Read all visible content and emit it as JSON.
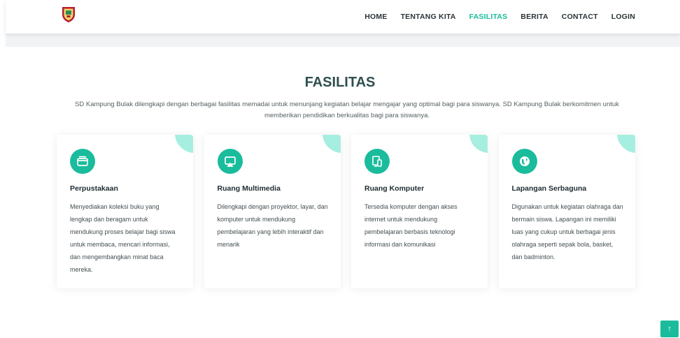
{
  "nav": {
    "items": [
      "HOME",
      "TENTANG KITA",
      "FASILITAS",
      "BERITA",
      "CONTACT",
      "LOGIN"
    ],
    "active": "FASILITAS"
  },
  "section": {
    "title": "FASILITAS",
    "description": "SD Kampung Bulak dilengkapi dengan berbagai fasilitas memadai untuk menunjang kegiatan belajar mengajar yang optimal bagi para siswanya. SD Kampung Bulak berkomitmen untuk memberikan pendidikan berkualitas bagi para siswanya."
  },
  "facilities": [
    {
      "icon": "library-box-icon",
      "title": "Perpustakaan",
      "text": "Menyediakan koleksi buku yang lengkap dan beragam untuk mendukung proses belajar bagi siswa untuk membaca, mencari informasi, dan mengembangkan minat baca mereka."
    },
    {
      "icon": "airplay-screen-icon",
      "title": "Ruang Multimedia",
      "text": "Dilengkapi dengan proyektor, layar, dan komputer untuk mendukung pembelajaran yang lebih interaktif dan menarik"
    },
    {
      "icon": "devices-icon",
      "title": "Ruang Komputer",
      "text": "Tersedia komputer dengan akses internet untuk mendukung pembelajaran berbasis teknologi informasi dan komunikasi"
    },
    {
      "icon": "globe-icon",
      "title": "Lapangan Serbaguna",
      "text": "Digunakan untuk kegiatan olahraga dan bermain siswa. Lapangan ini memiliki luas yang cukup untuk berbagai jenis olahraga seperti sepak bola, basket, dan badminton."
    }
  ],
  "back_to_top": "↑",
  "colors": {
    "accent": "#1abc9c",
    "accent_light": "#a6eee0",
    "heading": "#2f4f4f"
  }
}
